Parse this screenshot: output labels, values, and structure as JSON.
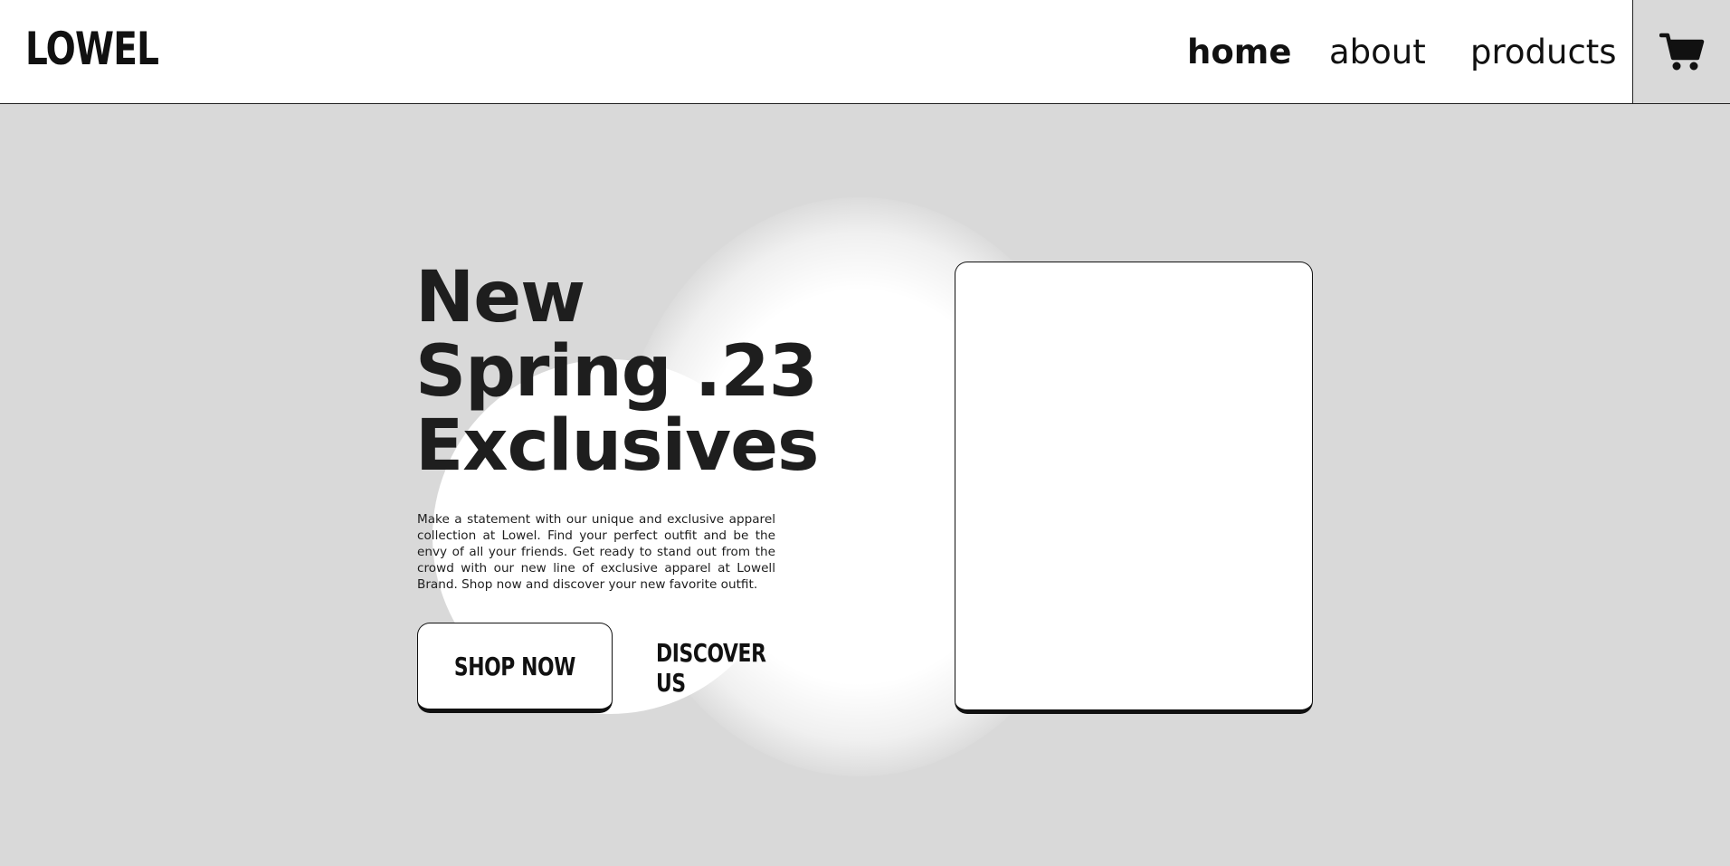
{
  "header": {
    "logo": "LOWEL",
    "nav": [
      {
        "label": "home",
        "active": true
      },
      {
        "label": "about",
        "active": false
      },
      {
        "label": "products",
        "active": false
      }
    ],
    "cart_icon": "shopping-cart-icon"
  },
  "hero": {
    "headline_lines": [
      "New",
      "Spring .23",
      "Exclusives"
    ],
    "description": "Make a statement with our unique and exclusive apparel collection at Lowel. Find your perfect outfit and be the envy of all your friends. Get ready to stand out from the crowd with our new line of exclusive apparel at Lowell Brand. Shop now and discover your new favorite outfit.",
    "primary_button": "SHOP NOW",
    "secondary_button": "DISCOVER US"
  },
  "colors": {
    "background": "#d9d9d9",
    "header_background": "#ffffff",
    "text": "#1e1e1e",
    "card": "#ffffff"
  }
}
